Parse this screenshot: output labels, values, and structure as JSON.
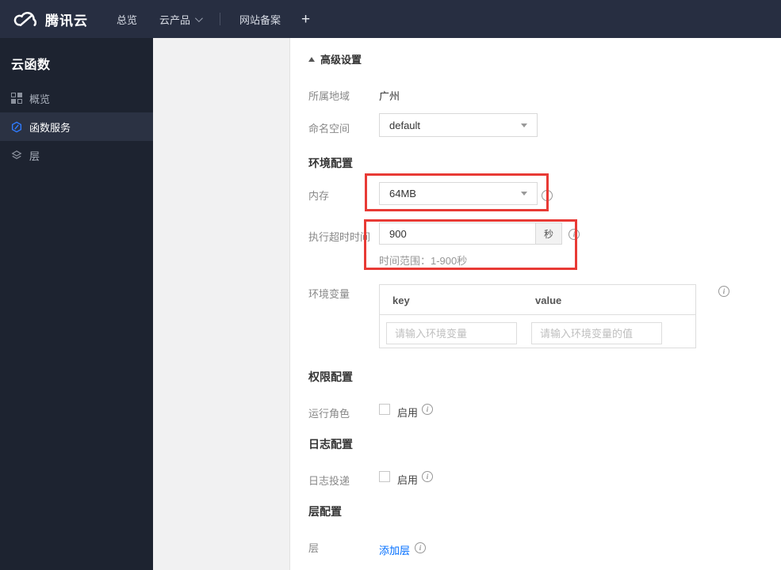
{
  "navbar": {
    "brand": "腾讯云",
    "items": [
      {
        "label": "总览"
      },
      {
        "label": "云产品"
      },
      {
        "label": "网站备案"
      }
    ],
    "plus_label": "+"
  },
  "sidebar": {
    "title": "云函数",
    "items": [
      {
        "label": "概览",
        "icon": "grid-icon",
        "active": false
      },
      {
        "label": "函数服务",
        "icon": "hexagon-function-icon",
        "active": true
      },
      {
        "label": "层",
        "icon": "layers-icon",
        "active": false
      }
    ]
  },
  "main": {
    "advanced_settings": "高级设置",
    "region": {
      "label": "所属地域",
      "value": "广州"
    },
    "namespace": {
      "label": "命名空间",
      "value": "default"
    },
    "sections": {
      "env": "环境配置",
      "perm": "权限配置",
      "log": "日志配置",
      "layer": "层配置"
    },
    "memory": {
      "label": "内存",
      "value": "64MB"
    },
    "timeout": {
      "label": "执行超时时间",
      "value": "900",
      "unit": "秒",
      "hint": "时间范围：1-900秒"
    },
    "env_vars": {
      "label": "环境变量",
      "key_header": "key",
      "value_header": "value",
      "key_placeholder": "请输入环境变量",
      "value_placeholder": "请输入环境变量的值"
    },
    "role": {
      "label": "运行角色",
      "enable": "启用"
    },
    "log_row": {
      "label": "日志投递",
      "enable": "启用"
    },
    "layer_row": {
      "label": "层",
      "add_link": "添加层"
    }
  },
  "colors": {
    "navbar_bg": "#272e41",
    "sidebar_bg": "#1d2330",
    "sidebar_active_bg": "#2b3243",
    "accent_blue": "#006eff",
    "highlight_red": "#e83a35",
    "panel_gray": "#f1f1f2"
  }
}
